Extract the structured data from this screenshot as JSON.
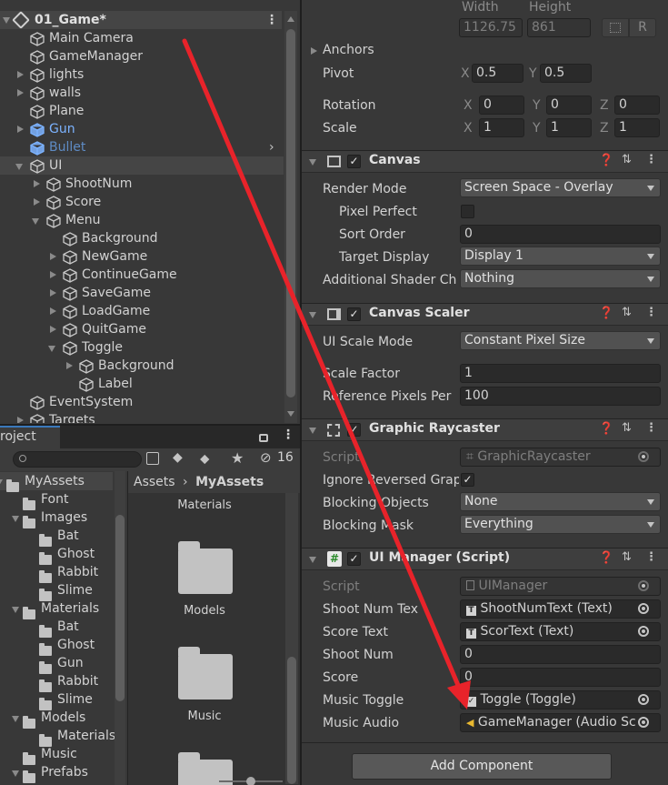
{
  "hierarchy": {
    "scene": "01_Game*",
    "items": [
      {
        "label": "Main Camera",
        "indent": 0,
        "arrow": "",
        "color": "#d2d2d2"
      },
      {
        "label": "GameManager",
        "indent": 0,
        "arrow": "",
        "color": "#d2d2d2"
      },
      {
        "label": "lights",
        "indent": 0,
        "arrow": "right",
        "color": "#d2d2d2"
      },
      {
        "label": "walls",
        "indent": 0,
        "arrow": "right",
        "color": "#d2d2d2"
      },
      {
        "label": "Plane",
        "indent": 0,
        "arrow": "",
        "color": "#d2d2d2"
      },
      {
        "label": "Gun",
        "indent": 0,
        "arrow": "right",
        "color": "#7cb3ff"
      },
      {
        "label": "Bullet",
        "indent": 0,
        "arrow": "",
        "color": "#5e8bc4"
      },
      {
        "label": "UI",
        "indent": 0,
        "arrow": "down",
        "color": "#d2d2d2"
      },
      {
        "label": "ShootNum",
        "indent": 1,
        "arrow": "right",
        "color": "#d2d2d2"
      },
      {
        "label": "Score",
        "indent": 1,
        "arrow": "right",
        "color": "#d2d2d2"
      },
      {
        "label": "Menu",
        "indent": 1,
        "arrow": "down",
        "color": "#d2d2d2"
      },
      {
        "label": "Background",
        "indent": 2,
        "arrow": "",
        "color": "#d2d2d2"
      },
      {
        "label": "NewGame",
        "indent": 2,
        "arrow": "right",
        "color": "#d2d2d2"
      },
      {
        "label": "ContinueGame",
        "indent": 2,
        "arrow": "right",
        "color": "#d2d2d2"
      },
      {
        "label": "SaveGame",
        "indent": 2,
        "arrow": "right",
        "color": "#d2d2d2"
      },
      {
        "label": "LoadGame",
        "indent": 2,
        "arrow": "right",
        "color": "#d2d2d2"
      },
      {
        "label": "QuitGame",
        "indent": 2,
        "arrow": "right",
        "color": "#d2d2d2"
      },
      {
        "label": "Toggle",
        "indent": 2,
        "arrow": "down",
        "color": "#d2d2d2"
      },
      {
        "label": "Background",
        "indent": 3,
        "arrow": "right",
        "color": "#d2d2d2"
      },
      {
        "label": "Label",
        "indent": 3,
        "arrow": "",
        "color": "#d2d2d2"
      },
      {
        "label": "EventSystem",
        "indent": 0,
        "arrow": "",
        "color": "#d2d2d2"
      },
      {
        "label": "Targets",
        "indent": 0,
        "arrow": "right",
        "color": "#d2d2d2"
      }
    ]
  },
  "project": {
    "tab": "roject",
    "hidden_count": "16",
    "breadcrumb": [
      "Assets",
      "MyAssets"
    ],
    "tree": [
      {
        "label": "MyAssets",
        "indent": 0,
        "arrow": "down"
      },
      {
        "label": "Font",
        "indent": 1,
        "arrow": ""
      },
      {
        "label": "Images",
        "indent": 1,
        "arrow": "down"
      },
      {
        "label": "Bat",
        "indent": 2,
        "arrow": ""
      },
      {
        "label": "Ghost",
        "indent": 2,
        "arrow": ""
      },
      {
        "label": "Rabbit",
        "indent": 2,
        "arrow": ""
      },
      {
        "label": "Slime",
        "indent": 2,
        "arrow": ""
      },
      {
        "label": "Materials",
        "indent": 1,
        "arrow": "down"
      },
      {
        "label": "Bat",
        "indent": 2,
        "arrow": ""
      },
      {
        "label": "Ghost",
        "indent": 2,
        "arrow": ""
      },
      {
        "label": "Gun",
        "indent": 2,
        "arrow": ""
      },
      {
        "label": "Rabbit",
        "indent": 2,
        "arrow": ""
      },
      {
        "label": "Slime",
        "indent": 2,
        "arrow": ""
      },
      {
        "label": "Models",
        "indent": 1,
        "arrow": "down"
      },
      {
        "label": "Materials",
        "indent": 2,
        "arrow": ""
      },
      {
        "label": "Music",
        "indent": 1,
        "arrow": ""
      },
      {
        "label": "Prefabs",
        "indent": 1,
        "arrow": "down"
      }
    ],
    "grid": [
      "Materials",
      "Models",
      "Music"
    ]
  },
  "inspector": {
    "rect": {
      "width_label": "Width",
      "height_label": "Height",
      "width": "1126.75",
      "height": "861",
      "r_button": "R"
    },
    "anchors": "Anchors",
    "pivot": {
      "label": "Pivot",
      "x": "0.5",
      "y": "0.5"
    },
    "rotation": {
      "label": "Rotation",
      "x": "0",
      "y": "0",
      "z": "0"
    },
    "scale": {
      "label": "Scale",
      "x": "1",
      "y": "1",
      "z": "1"
    },
    "axis": {
      "x": "X",
      "y": "Y",
      "z": "Z"
    },
    "canvas": {
      "title": "Canvas",
      "render_mode_label": "Render Mode",
      "render_mode": "Screen Space - Overlay",
      "pixel_perfect_label": "Pixel Perfect",
      "sort_order_label": "Sort Order",
      "sort_order": "0",
      "target_display_label": "Target Display",
      "target_display": "Display 1",
      "shader_label": "Additional Shader Ch",
      "shader": "Nothing"
    },
    "scaler": {
      "title": "Canvas Scaler",
      "mode_label": "UI Scale Mode",
      "mode": "Constant Pixel Size",
      "factor_label": "Scale Factor",
      "factor": "1",
      "ref_label": "Reference Pixels Per",
      "ref": "100"
    },
    "raycaster": {
      "title": "Graphic Raycaster",
      "script_label": "Script",
      "script": "GraphicRaycaster",
      "ignore_label": "Ignore Reversed Grap",
      "blocking_label": "Blocking Objects",
      "blocking": "None",
      "mask_label": "Blocking Mask",
      "mask": "Everything"
    },
    "uimanager": {
      "title": "UI Manager (Script)",
      "script_label": "Script",
      "script": "UIManager",
      "shootnum_text_label": "Shoot Num Tex",
      "shootnum_text": "ShootNumText (Text)",
      "score_text_label": "Score Text",
      "score_text": "ScorText (Text)",
      "shootnum_label": "Shoot Num",
      "shootnum": "0",
      "score_label": "Score",
      "score": "0",
      "toggle_label": "Music Toggle",
      "toggle": "Toggle (Toggle)",
      "audio_label": "Music Audio",
      "audio": "GameManager (Audio Sc"
    },
    "add_component": "Add Component"
  },
  "search": {
    "placeholder": ""
  },
  "colors": {
    "annotation_arrow": "#e8232a",
    "prefab_blue": "#7cb3ff"
  }
}
